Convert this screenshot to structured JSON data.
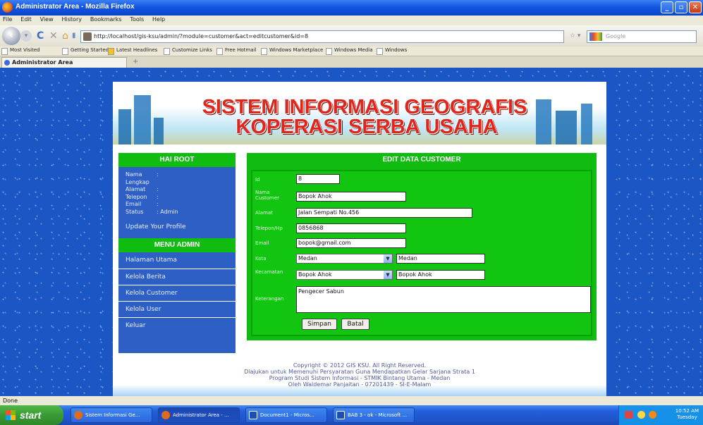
{
  "window": {
    "title": "Administrator Area - Mozilla Firefox"
  },
  "menu": [
    "File",
    "Edit",
    "View",
    "History",
    "Bookmarks",
    "Tools",
    "Help"
  ],
  "nav": {
    "url": "http://localhost/gis-ksu/admin/?module=customer&act=editcustomer&id=8",
    "search_placeholder": "Google"
  },
  "bookmarks": [
    "Most Visited",
    "Getting Started",
    "Latest Headlines",
    "Customize Links",
    "Free Hotmail",
    "Windows Marketplace",
    "Windows Media",
    "Windows"
  ],
  "tab": {
    "label": "Administrator Area"
  },
  "banner": {
    "line1": "SISTEM INFORMASI GEOGRAFIS",
    "line2": "KOPERASI SERBA USAHA"
  },
  "sidebar": {
    "greeting": "HAI ROOT",
    "info": [
      {
        "k": "Nama Lengkap",
        "v": ":"
      },
      {
        "k": "Alamat",
        "v": ":"
      },
      {
        "k": "Telepon",
        "v": ":"
      },
      {
        "k": "Email",
        "v": ":"
      },
      {
        "k": "Status",
        "v": ": Admin"
      }
    ],
    "update_link": "Update Your Profile",
    "menu_title": "MENU ADMIN",
    "menu": [
      "Halaman Utama",
      "Kelola Berita",
      "Kelola Customer",
      "Kelola User",
      "Keluar"
    ]
  },
  "form": {
    "title": "EDIT DATA CUSTOMER",
    "labels": {
      "id": "Id",
      "nama": "Nama Customer",
      "alamat": "Alamat",
      "telepon": "Telepon/Hp",
      "email": "Email",
      "kota": "Kota",
      "desa": "Kecamatan",
      "keterangan": "Keterangan"
    },
    "values": {
      "id": "8",
      "nama": "Bopok Ahok",
      "alamat": "Jalan Sempati No.456",
      "telepon": "0856868",
      "email": "bopok@gmail.com",
      "kota_select": "Medan",
      "kota_text": "Medan",
      "desa_select": "Bopok Ahok",
      "desa_text": "Bopok Ahok",
      "keterangan": "Pengecer Sabun"
    },
    "save_label": "Simpan",
    "cancel_label": "Batal"
  },
  "footer": {
    "line1": "Copyright © 2012 GIS KSU. All Right Reserved.",
    "line2": "Diajukan untuk Memenuhi Persyaratan Guna Mendapatkan Gelar Sarjana Strata 1",
    "line3": "Program Studi Sistem Informasi - STMIK Bintang Utama - Medan",
    "line4": "Oleh Waldemar Panjaitan - 07201439 - SI-E-Malam"
  },
  "status": "Done",
  "taskbar": {
    "start_label": "start",
    "items": [
      "Sistem Informasi Ge...",
      "Administrator Area - ...",
      "Document1 - Micros...",
      "BAB 3 - ok - Microsoft ..."
    ],
    "time": "10:52 AM",
    "day": "Tuesday"
  }
}
